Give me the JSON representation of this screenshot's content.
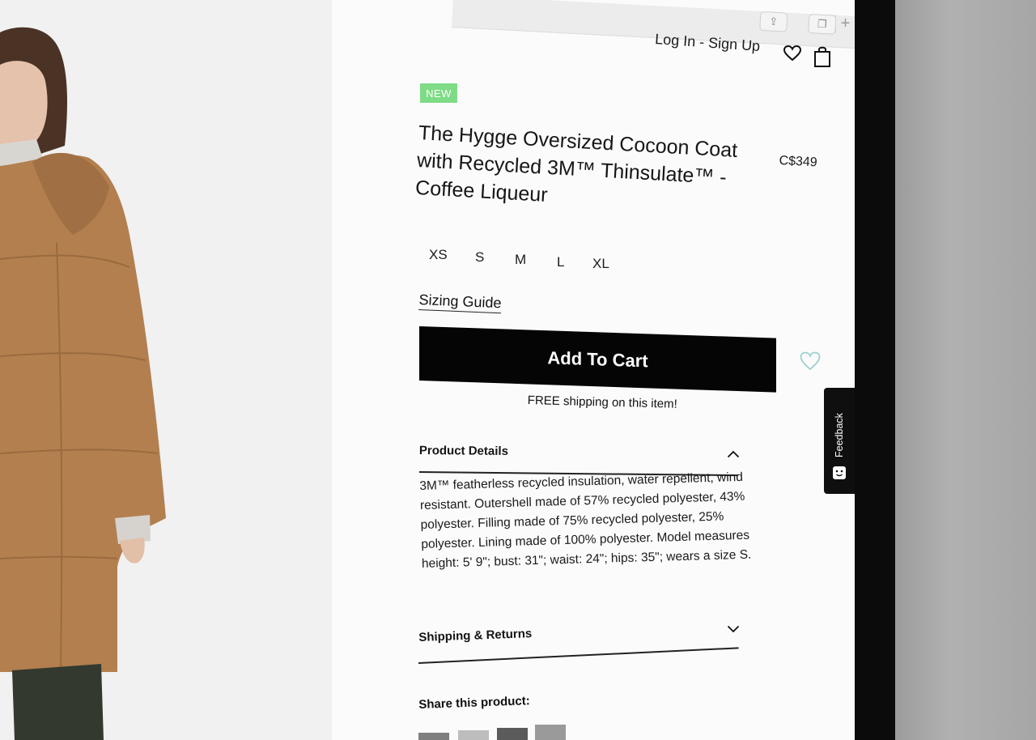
{
  "browser": {
    "share_glyph": "⇪",
    "tabs_glyph": "❐",
    "new_tab_glyph": "+"
  },
  "header": {
    "auth_link": "Log In - Sign Up",
    "wishlist_icon": "heart-icon",
    "bag_icon": "shopping-bag-icon"
  },
  "product": {
    "badge": "NEW",
    "title": "The Hygge Oversized Cocoon Coat with Recycled 3M™ Thinsulate™ - Coffee Liqueur",
    "price": "C$349",
    "sizes": [
      "XS",
      "S",
      "M",
      "L",
      "XL"
    ],
    "sizing_guide": "Sizing Guide",
    "add_to_cart": "Add To Cart",
    "free_shipping": "FREE shipping on this item!"
  },
  "accordion": {
    "details_title": "Product Details",
    "details_body": "3M™ featherless recycled insulation, water repellent, wind resistant. Outershell made of 57% recycled polyester, 43% polyester. Filling made of 75% recycled polyester, 25% polyester. Lining made of 100% polyester. Model measures height: 5' 9\"; bust: 31\"; waist: 24\"; hips: 35\"; wears a size S.",
    "shipping_title": "Shipping & Returns"
  },
  "share": {
    "label": "Share this product:"
  },
  "feedback": {
    "label": "Feedback"
  },
  "colors": {
    "badge": "#7edb86",
    "cart_button": "#050505",
    "wishlist_outline": "#9ecfcf",
    "coat": "#b37f4f"
  }
}
